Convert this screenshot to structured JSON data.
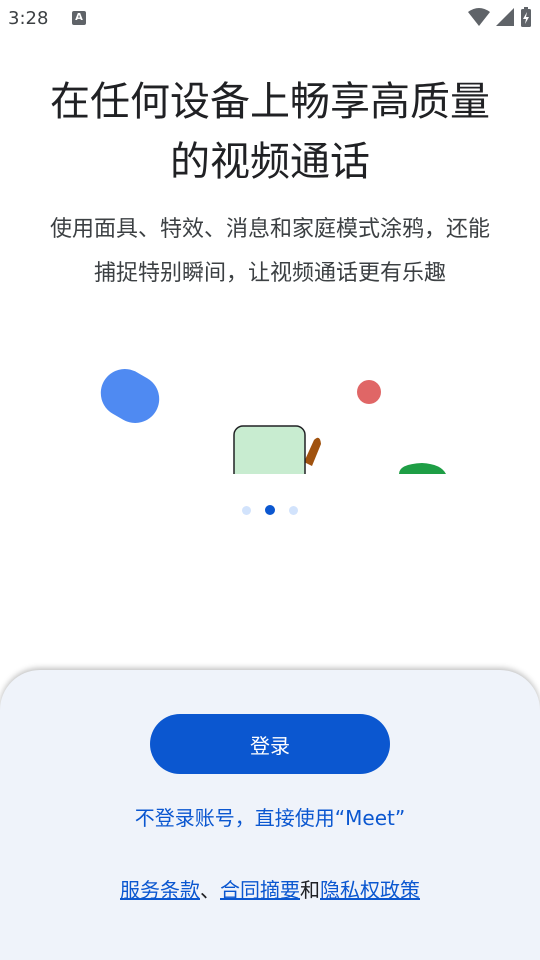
{
  "status_bar": {
    "time": "3:28",
    "notification_icon": "a-icon",
    "icons": [
      "wifi-icon",
      "signal-icon",
      "battery-charging-icon"
    ]
  },
  "onboarding": {
    "headline_line1": "在任何设备上畅享高质量",
    "headline_line2": "的视频通话",
    "subtitle_line1": "使用面具、特效、消息和家庭模式涂鸦，还能",
    "subtitle_line2": "捕捉特别瞬间，让视频通话更有乐趣",
    "page_indicator": {
      "total": 3,
      "current": 2
    }
  },
  "actions": {
    "signin_label": "登录",
    "guest_label": "不登录账号，直接使用“Meet”"
  },
  "legal": {
    "terms": "服务条款",
    "sep1": "、",
    "summary": "合同摘要",
    "sep2": "和",
    "privacy": "隐私权政策"
  },
  "colors": {
    "primary": "#0b57d0",
    "sheet_bg": "#eff3fa",
    "blue_shape": "#4f8af2",
    "red_shape": "#e06666",
    "green_shape": "#1e9e45",
    "mint_shape": "#c8ecd0",
    "brown_shape": "#a0520f"
  }
}
